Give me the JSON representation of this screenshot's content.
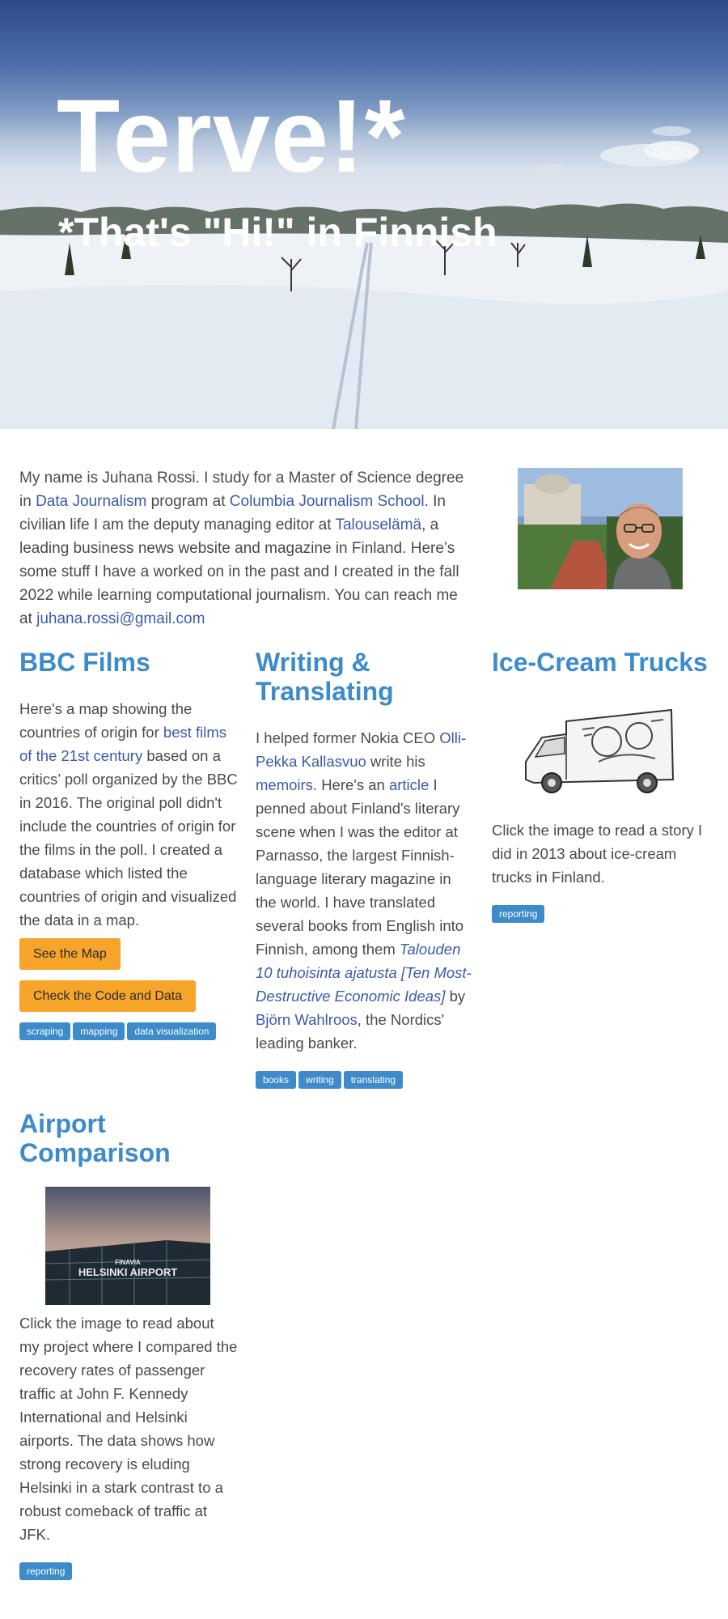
{
  "hero": {
    "title": "Terve!*",
    "subtitle": "*That's \"Hi!\" in Finnish"
  },
  "intro": {
    "t1": "My name is Juhana Rossi. I study for a Master of Science degree in ",
    "link1": "Data Journalism",
    "t2": " program at ",
    "link2": "Columbia Journalism School",
    "t3": ". In civilian life I am the deputy managing editor at ",
    "link3": "Talouselämä",
    "t4": ", a leading business news website and magazine in Finland. Here’s some stuff I have a worked on in the past and I created in the fall 2022 while learning computational journalism. You can reach me at ",
    "email": "juhana.rossi@gmail.com"
  },
  "bbc": {
    "title": "BBC Films",
    "t1": "Here's a map showing the countries of origin for ",
    "link": "best films of the 21st century",
    "t2": " based on a critics’ poll organized by the BBC in 2016. The original poll didn't include the countries of origin for the films in the poll. I created a database which listed the countries of origin and visualized the data in a map.",
    "button1": "See the Map",
    "button2": "Check the Code and Data",
    "tags": [
      "scraping",
      "mapping",
      "data visualization"
    ]
  },
  "writing": {
    "title": "Writing & Translating",
    "t1": "I helped former Nokia CEO ",
    "link1": "Olli-Pekka Kallasvuo",
    "t2": " write his ",
    "link2": "memoirs",
    "t3": ". Here's an ",
    "link3": "article",
    "t4": " I penned about Finland's literary scene when I was the editor at Parnasso, the largest Finnish-language literary magazine in the world. I have translated several books from English into Finnish, among them ",
    "book": "Talouden 10 tuhoisinta ajatusta [Ten Most-Destructive Economic Ideas]",
    "t5": " by ",
    "link4": "Björn Wahlroos",
    "t6": ", the Nordics' leading banker.",
    "tags": [
      "books",
      "writing",
      "translating"
    ]
  },
  "icecream": {
    "title": "Ice-Cream Trucks",
    "text": "Click the image to read a story I did in 2013 about ice-cream trucks in Finland.",
    "tags": [
      "reporting"
    ]
  },
  "airport": {
    "title": "Airport Comparison",
    "sign_text": "HELSINKI AIRPORT",
    "sign_brand": "FINAVIA",
    "text": "Click the image to read about my project where I compared the recovery rates of passenger traffic at John F. Kennedy International and Helsinki airports. The data shows how strong recovery is eluding Helsinki in a stark contrast to a robust comeback of traffic at JFK.",
    "tags": [
      "reporting"
    ]
  },
  "colors": {
    "accent": "#3d8bcb",
    "link": "#3b5aa8",
    "button": "#f6a52a",
    "text": "#4a4a4a"
  }
}
